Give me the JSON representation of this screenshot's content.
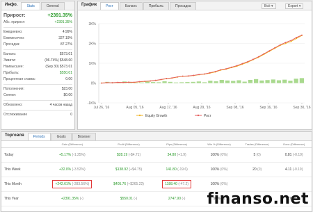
{
  "left": {
    "title": "Инфо.",
    "tabs": [
      "Stats",
      "General"
    ],
    "rows": [
      {
        "label": "Прирост:",
        "value": "+2391.35%"
      },
      {
        "label": "Абс. прирост:",
        "value": "+2391.35%"
      },
      {
        "label": "Ежедневно:",
        "value": "4.99%"
      },
      {
        "label": "Ежемесячно:",
        "value": "327.19%"
      },
      {
        "label": "Просадка:",
        "value": "87.27%"
      },
      {
        "label": "Баланс:",
        "value": "$573.01"
      },
      {
        "label": "Эквити:",
        "value": "(96.74%) $548.60"
      },
      {
        "label": "Наивысшее:",
        "value": "(Sep 30) $573.01"
      },
      {
        "label": "Прибыль:",
        "value": "$550.01"
      },
      {
        "label": "Процентная ставка:",
        "value": "0.00"
      },
      {
        "label": "Пополнения:",
        "value": "$23.00"
      },
      {
        "label": "Снятия:",
        "value": "$0.00"
      },
      {
        "label": "Обновлено:",
        "value": "4 часов назад"
      },
      {
        "label": "Отслеживание",
        "value": "0"
      }
    ]
  },
  "chart": {
    "title": "График",
    "tabs": [
      "Рост",
      "Баланс",
      "Прибыль",
      "Просадка"
    ],
    "dropdown": "Всё",
    "export": "Export",
    "legend": [
      "Equity Growth",
      "Рост"
    ],
    "colors": {
      "equity": "#f0b323",
      "growth": "#e45d5d",
      "bars": "#a9d98e"
    }
  },
  "chart_data": {
    "type": "line",
    "x_ticks": [
      "Jul 26, '16",
      "Aug 05, '16",
      "Aug 17, '16",
      "Aug 29, '16",
      "Sep 08, '16",
      "Sep 16, '16",
      "Sep 30, '16"
    ],
    "y_ticks": [
      "3K%",
      "2K%",
      "1K%",
      "0%",
      "-1K%"
    ],
    "ylim": [
      -1000,
      3000
    ],
    "series": [
      {
        "name": "Equity Growth",
        "values": [
          0,
          20,
          10,
          30,
          25,
          40,
          30,
          60,
          80,
          100,
          130,
          170,
          220,
          250,
          300,
          340,
          350,
          380,
          420,
          450,
          500,
          560,
          650,
          700,
          780,
          850,
          950,
          1050,
          1180,
          1300,
          1450,
          1600,
          1750,
          1900,
          2000,
          2100,
          2250,
          2400
        ]
      },
      {
        "name": "Рост",
        "values": [
          0,
          20,
          15,
          35,
          30,
          45,
          40,
          70,
          90,
          110,
          140,
          180,
          230,
          260,
          310,
          350,
          360,
          390,
          430,
          460,
          520,
          580,
          670,
          720,
          800,
          880,
          980,
          1080,
          1200,
          1330,
          1480,
          1630,
          1780,
          1930,
          2050,
          2150,
          2300,
          2420
        ]
      }
    ],
    "bars": [
      10,
      60,
      40,
      30,
      80,
      40,
      20,
      30,
      70,
      50,
      40,
      90,
      60,
      30,
      40,
      50,
      60,
      80,
      40,
      120,
      90,
      160,
      130,
      110,
      140,
      70,
      160,
      200,
      130,
      150,
      180,
      140,
      170,
      120,
      220,
      250
    ]
  },
  "bottom": {
    "title": "Торговля",
    "tabs": [
      "Periods",
      "Goals",
      "Browser"
    ],
    "headers": [
      "Gain (Difference)",
      "Profit (Difference)",
      "Pips (Difference)",
      "Win % (Difference)",
      "Trades (Difference)",
      "Лоты (Difference)"
    ],
    "rows": [
      {
        "name": "Today",
        "gain": "+5.17%",
        "gain_d": "(-1.25%)",
        "profit": "$28.19",
        "profit_d": "(-$4.71)",
        "pips": "34.80",
        "pips_d": "(+1.9)",
        "win": "100%",
        "win_d": "(0%)",
        "trades": "5",
        "trades_d": "(0)",
        "lots": "0.81",
        "lots_d": "(-0.19)"
      },
      {
        "name": "This Week",
        "gain": "+32.0%",
        "gain_d": "(-3.52%)",
        "profit": "$138.92",
        "profit_d": "(+$4.75)",
        "pips": "141.80",
        "pips_d": "(-19.6)",
        "win": "100%",
        "win_d": "(0%)",
        "trades": "20",
        "trades_d": "(0)",
        "lots": "4.11",
        "lots_d": "(-0.19)"
      },
      {
        "name": "This Month",
        "gain": "+242.61%",
        "gain_d": "(-283.56%)",
        "profit": "$405.76",
        "profit_d": "(+$265.22)",
        "pips": "1188.40",
        "pips_d": "(-47.2)",
        "win": "100%",
        "win_d": "(0%)",
        "trades": "",
        "trades_d": "",
        "lots": "",
        "lots_d": ""
      },
      {
        "name": "This Year",
        "gain": "+2391.35%",
        "gain_d": "(-)",
        "profit": "$550.01",
        "profit_d": "(-)",
        "pips": "2747.90",
        "pips_d": "(-)",
        "win": "90%",
        "win_d": "(-)",
        "trades": "",
        "trades_d": "",
        "lots": "27.78",
        "lots_d": "(-)"
      }
    ]
  },
  "watermark": "finanso.net"
}
